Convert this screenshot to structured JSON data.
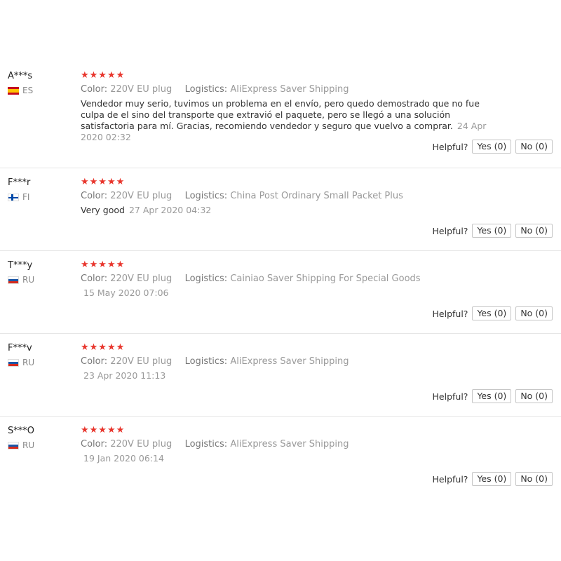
{
  "labels": {
    "color": "Color:",
    "logistics": "Logistics:",
    "helpful": "Helpful?"
  },
  "stars": "★★★★★",
  "reviews": [
    {
      "user": "A***s",
      "country": "ES",
      "color": "220V EU plug",
      "logistics": "AliExpress Saver Shipping",
      "text": "Vendedor muy serio, tuvimos un problema en el envío, pero quedo demostrado que no fue culpa de el sino del transporte que extravió el paquete, pero se llegó a una solución satisfactoria para mí. Gracias, recomiendo vendedor y seguro que vuelvo a comprar.",
      "date": "24 Apr 2020 02:32",
      "yes": "Yes (0)",
      "no": "No (0)"
    },
    {
      "user": "F***r",
      "country": "FI",
      "color": "220V EU plug",
      "logistics": "China Post Ordinary Small Packet Plus",
      "text": "Very good",
      "date": "27 Apr 2020 04:32",
      "yes": "Yes (0)",
      "no": "No (0)"
    },
    {
      "user": "T***y",
      "country": "RU",
      "color": "220V EU plug",
      "logistics": "Cainiao Saver Shipping For Special Goods",
      "text": "",
      "date": "15 May 2020 07:06",
      "yes": "Yes (0)",
      "no": "No (0)"
    },
    {
      "user": "F***v",
      "country": "RU",
      "color": "220V EU plug",
      "logistics": "AliExpress Saver Shipping",
      "text": "",
      "date": "23 Apr 2020 11:13",
      "yes": "Yes (0)",
      "no": "No (0)"
    },
    {
      "user": "S***O",
      "country": "RU",
      "color": "220V EU plug",
      "logistics": "AliExpress Saver Shipping",
      "text": "",
      "date": "19 Jan 2020 06:14",
      "yes": "Yes (0)",
      "no": "No (0)"
    }
  ]
}
